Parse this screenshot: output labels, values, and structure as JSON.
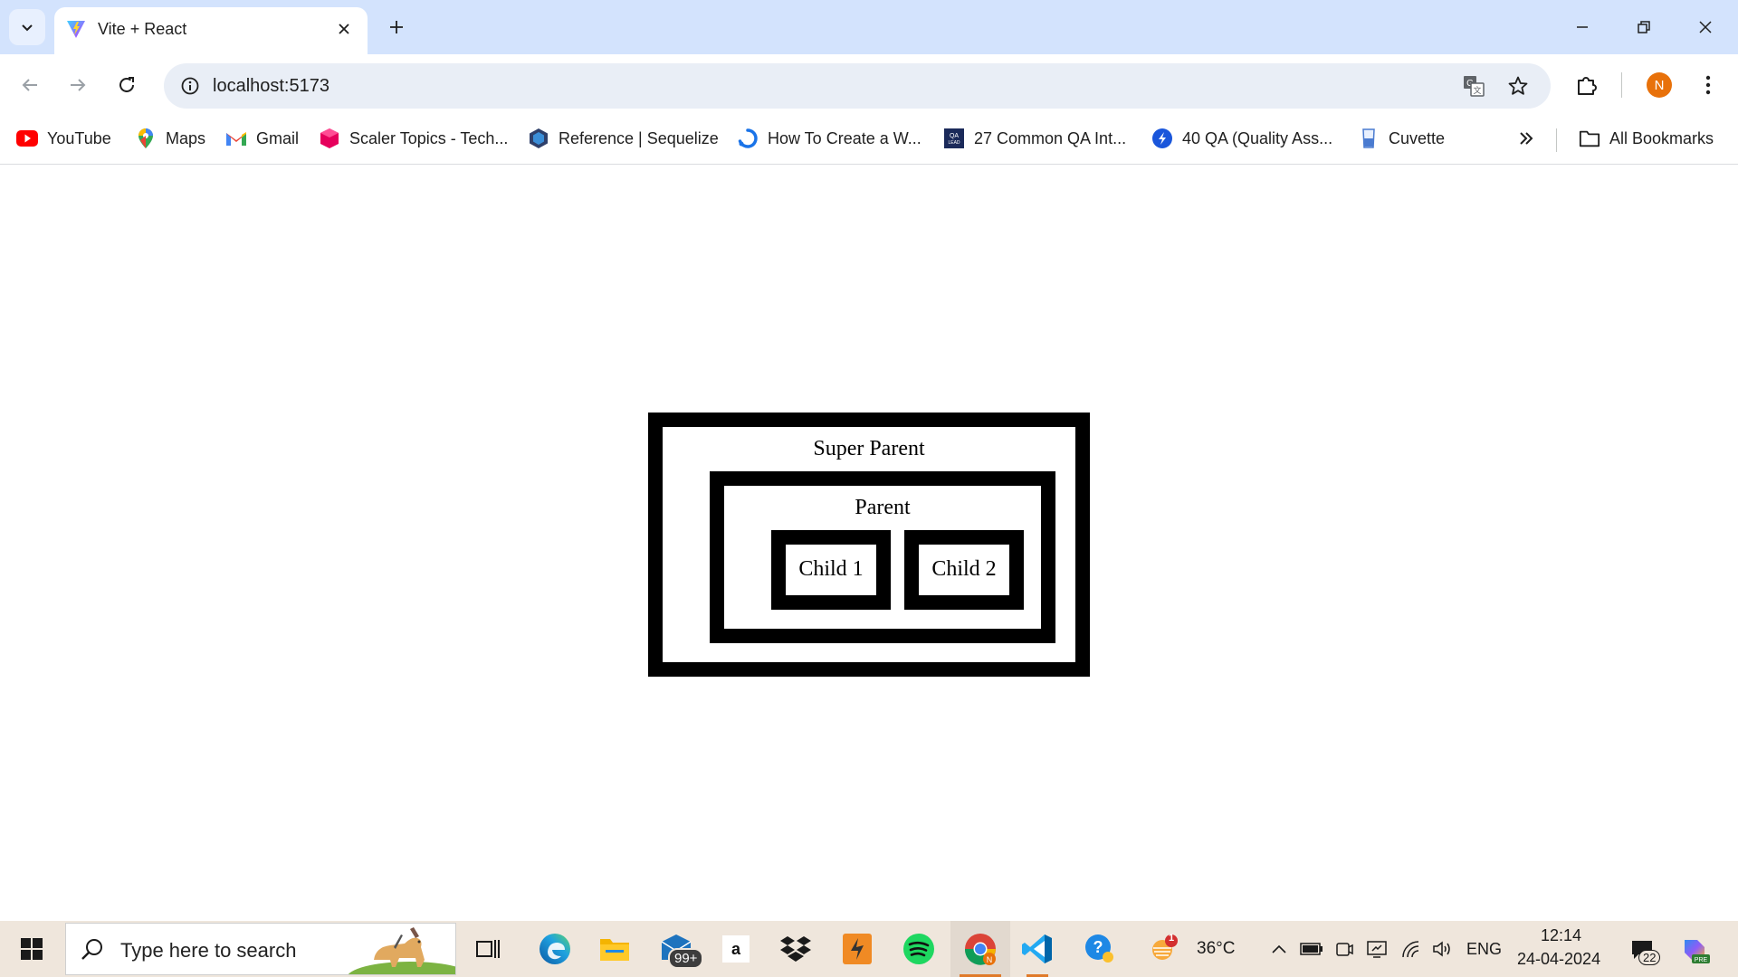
{
  "browser": {
    "tab": {
      "title": "Vite + React",
      "favicon": "vite-icon"
    },
    "address_bar": {
      "url": "localhost:5173"
    },
    "profile_initial": "N"
  },
  "bookmarks": [
    {
      "label": "YouTube",
      "icon": "youtube-icon"
    },
    {
      "label": "Maps",
      "icon": "maps-icon"
    },
    {
      "label": "Gmail",
      "icon": "gmail-icon"
    },
    {
      "label": "Scaler Topics - Tech...",
      "icon": "scaler-icon"
    },
    {
      "label": "Reference | Sequelize",
      "icon": "sequelize-icon"
    },
    {
      "label": "How To Create a W...",
      "icon": "loop-icon"
    },
    {
      "label": "27 Common QA Int...",
      "icon": "qa-lead-icon"
    },
    {
      "label": "40 QA (Quality Ass...",
      "icon": "globe-icon"
    },
    {
      "label": "Cuvette",
      "icon": "cuvette-icon"
    }
  ],
  "all_bookmarks_label": "All Bookmarks",
  "page": {
    "super_parent_label": "Super Parent",
    "parent_label": "Parent",
    "child1_label": "Child 1",
    "child2_label": "Child 2"
  },
  "taskbar": {
    "search_placeholder": "Type here to search",
    "mail_badge": "99+",
    "weather_temp": "36°C",
    "weather_badge": "1",
    "language": "ENG",
    "time": "12:14",
    "date": "24-04-2024",
    "notification_count": "22"
  }
}
